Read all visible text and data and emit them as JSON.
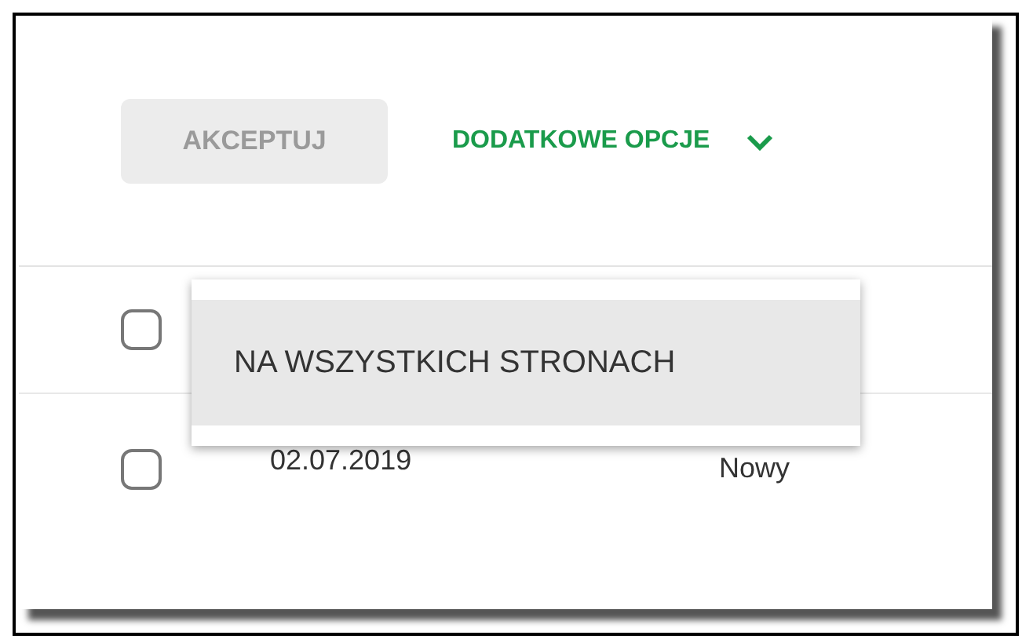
{
  "toolbar": {
    "accept_button": {
      "label": "AKCEPTUJ",
      "disabled": true
    },
    "more_options": {
      "label": "DODATKOWE OPCJE",
      "expanded": true
    }
  },
  "options_menu": [
    {
      "label": "NA WSZYSTKICH STRONACH",
      "selected": true
    }
  ],
  "table": {
    "select_all": {
      "checked": false
    },
    "rows": [
      {
        "checked": false,
        "column_2": "02.07.2019",
        "column_3": "Nowy"
      }
    ]
  }
}
